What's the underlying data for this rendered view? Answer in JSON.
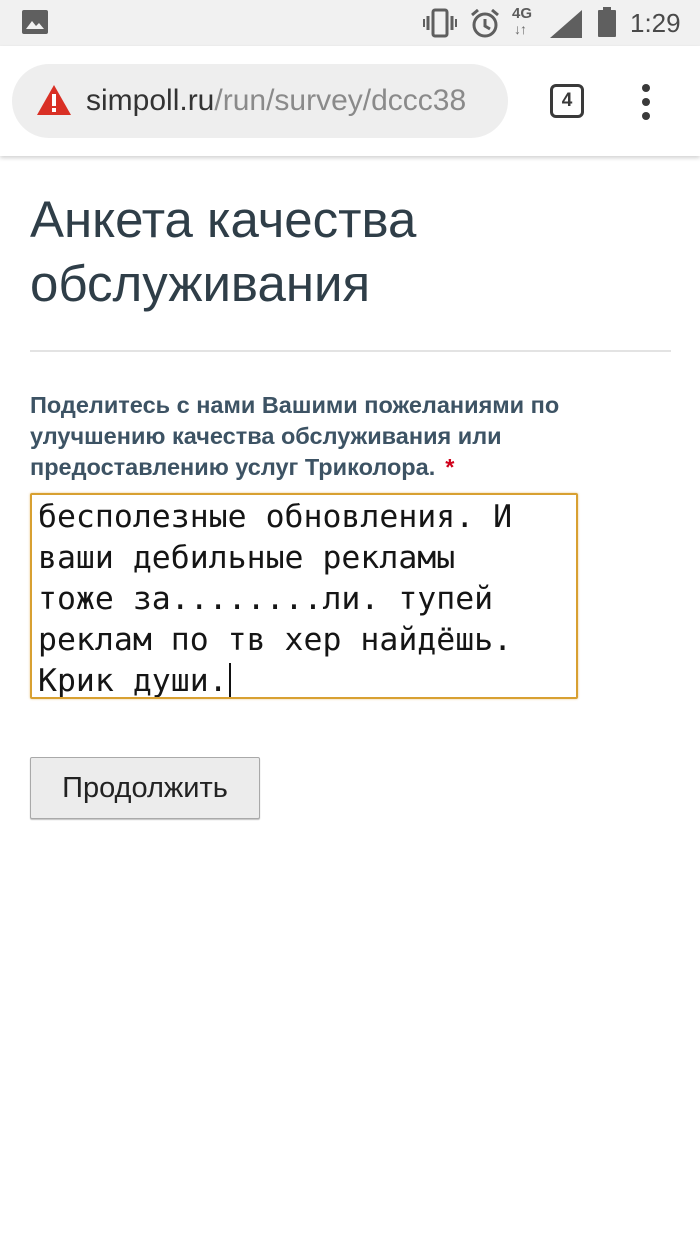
{
  "status_bar": {
    "network": "4G",
    "network_arrows": "↓↑",
    "time": "1:29",
    "icons": [
      "gallery-icon",
      "vibrate-icon",
      "alarm-icon",
      "signal-icon",
      "battery-icon"
    ]
  },
  "browser": {
    "url_domain": "simpoll.ru",
    "url_path": "/run/survey/dccc38",
    "security_icon": "warning-icon",
    "security_color": "#d93025",
    "tab_count": "4",
    "menu_icon": "overflow-menu-icon"
  },
  "survey": {
    "title": "Анкета качества обслуживания",
    "question": "Поделитесь с нами Вашими пожеланиями по улучшению качества обслуживания или предоставлению услуг Триколора.",
    "required_mark": "*",
    "answer": "бесполезные обновления. И\nваши дебильные рекламы\nтоже за........ли. тупей\nреклам по тв хер найдёшь.\nКрик души.",
    "continue_label": "Продолжить",
    "accent_color": "#d8a031"
  }
}
